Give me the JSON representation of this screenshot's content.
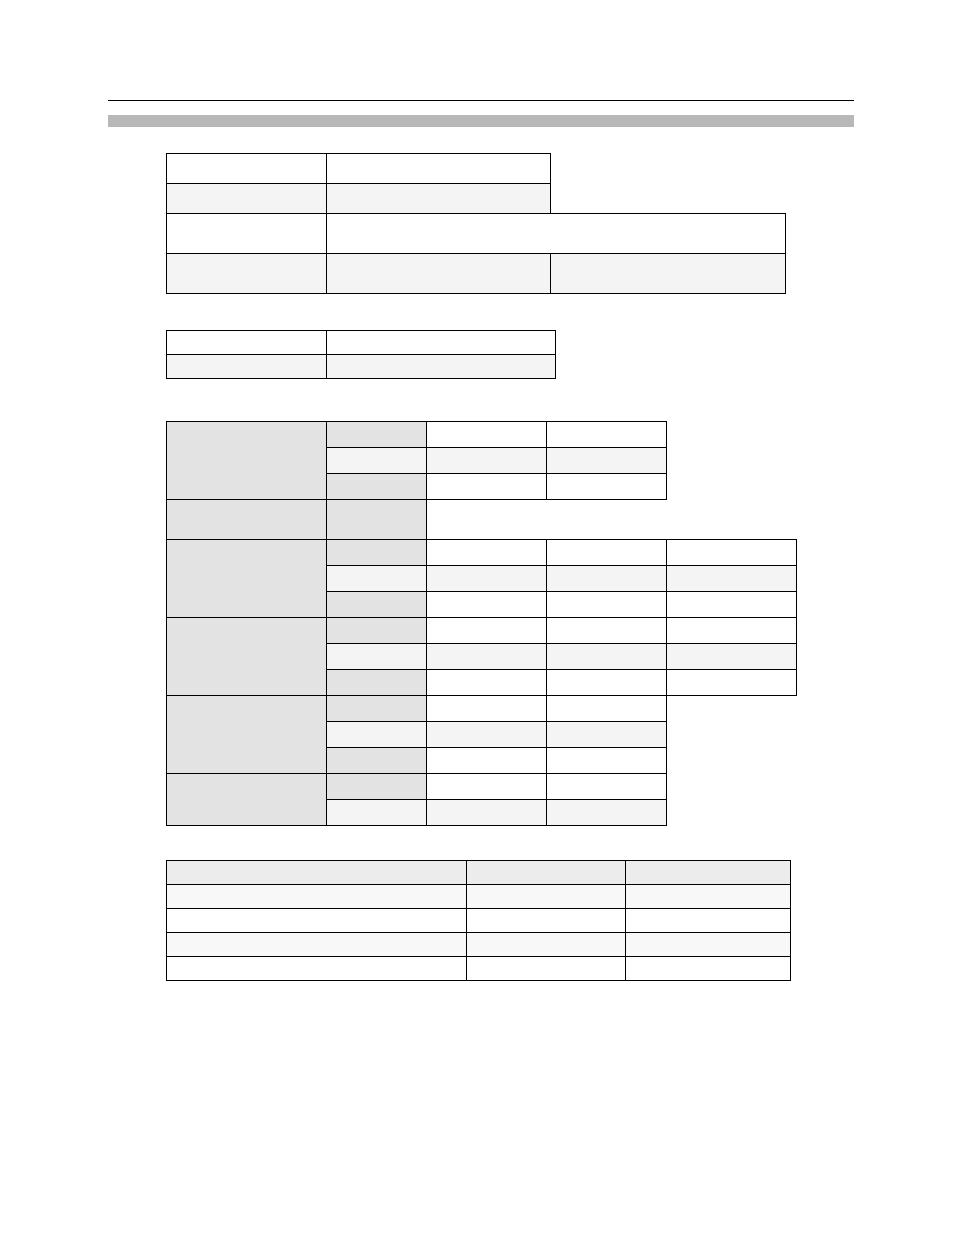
{
  "header": {
    "left": "",
    "right": ""
  },
  "title": " ",
  "sections": {
    "ident": {
      "title": " ",
      "rows": [
        {
          "label": "",
          "value": ""
        },
        {
          "label": "",
          "value": ""
        },
        {
          "label": "",
          "value": ""
        },
        {
          "label": "",
          "value": "",
          "extra": ""
        }
      ]
    },
    "gen": {
      "title": " ",
      "rows": [
        {
          "label": "",
          "value": ""
        },
        {
          "label": "",
          "value": ""
        }
      ]
    }
  },
  "ratings": {
    "abs": {
      "head": "",
      "rows": [
        {
          "k": "",
          "a": "",
          "b": ""
        },
        {
          "k": "",
          "a": "",
          "b": ""
        },
        {
          "k": "",
          "a": "",
          "b": ""
        }
      ]
    },
    "optemp": {
      "head": "",
      "val": ""
    },
    "rds": {
      "head": "",
      "rows": [
        {
          "k": "",
          "a": "",
          "b": "",
          "c": ""
        },
        {
          "k": "",
          "a": "",
          "b": "",
          "c": ""
        },
        {
          "k": "",
          "a": "",
          "b": "",
          "c": ""
        }
      ]
    },
    "sw": {
      "head": "",
      "rows": [
        {
          "k": "",
          "a": "",
          "b": "",
          "c": ""
        },
        {
          "k": "",
          "a": "",
          "b": "",
          "c": ""
        },
        {
          "k": "",
          "a": "",
          "b": "",
          "c": ""
        }
      ]
    },
    "cap": {
      "head": "",
      "rows": [
        {
          "k": "",
          "a": "",
          "b": ""
        },
        {
          "k": "",
          "a": "",
          "b": ""
        },
        {
          "k": "",
          "a": "",
          "b": ""
        }
      ]
    },
    "pkg": {
      "head": "",
      "rows": [
        {
          "k": "",
          "a": "",
          "b": ""
        },
        {
          "k": "",
          "a": "",
          "b": ""
        }
      ]
    }
  },
  "sources": {
    "headers": [
      "",
      "",
      ""
    ],
    "rows": [
      {
        "desc": "",
        "spec": "",
        "file": ""
      },
      {
        "desc": "",
        "spec": "",
        "file": ""
      },
      {
        "desc": "",
        "spec": "",
        "file": ""
      },
      {
        "desc": "",
        "spec": "",
        "file": ""
      }
    ]
  },
  "footer": {
    "left": "",
    "center": "",
    "right": ""
  }
}
